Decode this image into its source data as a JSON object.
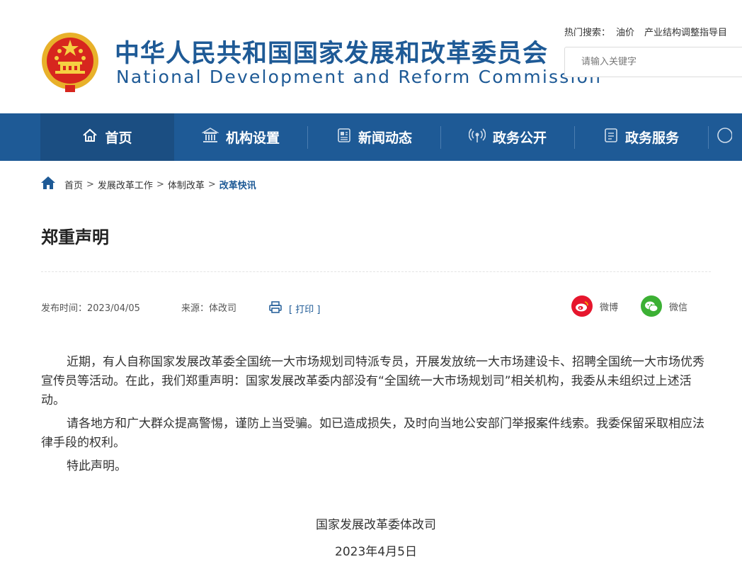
{
  "header": {
    "title_cn": "中华人民共和国国家发展和改革委员会",
    "title_en": "National Development and Reform Commission",
    "hot_label": "热门搜索：",
    "hot_keywords": [
      "油价",
      "产业结构调整指导目"
    ],
    "search_placeholder": "请输入关键字"
  },
  "nav": {
    "items": [
      {
        "label": "首页",
        "icon": "home-icon"
      },
      {
        "label": "机构设置",
        "icon": "building-icon"
      },
      {
        "label": "新闻动态",
        "icon": "newspaper-icon"
      },
      {
        "label": "政务公开",
        "icon": "broadcast-icon"
      },
      {
        "label": "政务服务",
        "icon": "document-icon"
      }
    ]
  },
  "breadcrumb": {
    "items": [
      "首页",
      "发展改革工作",
      "体制改革",
      "改革快讯"
    ],
    "separator": ">"
  },
  "article": {
    "title": "郑重声明",
    "publish_time": "发布时间：2023/04/05",
    "source": "来源：体改司",
    "print_label": "[ 打印 ]",
    "share_weibo": "微博",
    "share_wechat": "微信",
    "paragraphs": [
      "近期，有人自称国家发展改革委全国统一大市场规划司特派专员，开展发放统一大市场建设卡、招聘全国统一大市场优秀宣传员等活动。在此，我们郑重声明：国家发展改革委内部没有“全国统一大市场规划司”相关机构，我委从未组织过上述活动。",
      "请各地方和广大群众提高警惕，谨防上当受骗。如已造成损失，及时向当地公安部门举报案件线索。我委保留采取相应法律手段的权利。",
      "特此声明。"
    ],
    "signature": "国家发展改革委体改司",
    "date": "2023年4月5日"
  },
  "colors": {
    "brand_blue": "#1e5a96",
    "nav_active": "#1b4e82",
    "weibo_red": "#e6162d",
    "wechat_green": "#3cb034"
  }
}
